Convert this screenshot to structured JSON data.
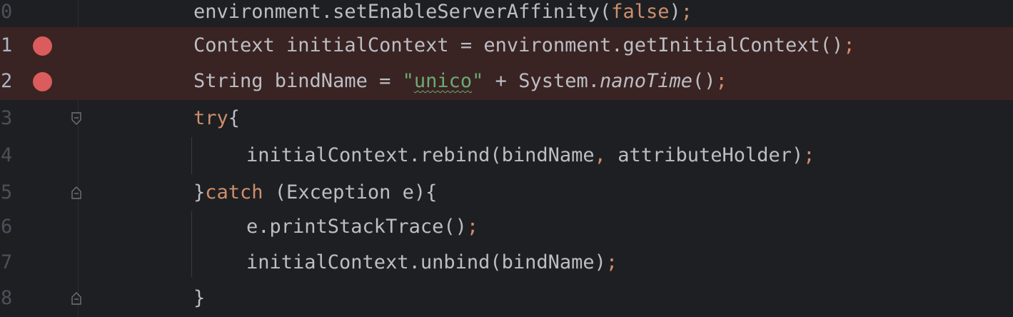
{
  "editor": {
    "lines": [
      {
        "number": "0",
        "breakpoint": false,
        "code": {
          "a": "environment.setEnableServerAffinity(",
          "b": "false",
          "c": ")",
          "d": ";"
        }
      },
      {
        "number": "1",
        "breakpoint": true,
        "code": {
          "a": "Context initialContext = environment.getInitialContext()",
          "b": ";"
        }
      },
      {
        "number": "2",
        "breakpoint": true,
        "code": {
          "a": "String bindName = ",
          "q1": "\"",
          "s": "unico",
          "q2": "\"",
          "b": " + System.",
          "c": "nanoTime",
          "d": "()",
          "e": ";"
        }
      },
      {
        "number": "3",
        "breakpoint": false,
        "code": {
          "a": "try",
          "b": "{"
        }
      },
      {
        "number": "4",
        "breakpoint": false,
        "code": {
          "a": "initialContext.rebind(bindName",
          "b": ",",
          "c": " attributeHolder)",
          "d": ";"
        }
      },
      {
        "number": "5",
        "breakpoint": false,
        "code": {
          "a": "}",
          "b": "catch",
          "c": " (Exception e){"
        }
      },
      {
        "number": "6",
        "breakpoint": false,
        "code": {
          "a": "e.printStackTrace()",
          "b": ";"
        }
      },
      {
        "number": "7",
        "breakpoint": false,
        "code": {
          "a": "initialContext.unbind(bindName)",
          "b": ";"
        }
      },
      {
        "number": "8",
        "breakpoint": false,
        "code": {
          "a": "}"
        }
      }
    ]
  },
  "colors": {
    "background": "#1e1f22",
    "breakpoint_line": "#3a2323",
    "breakpoint_dot": "#db5c5c",
    "keyword": "#cf8e6d",
    "string": "#6aab73",
    "text": "#bcbec4"
  },
  "icons": {
    "breakpoint": "breakpoint-icon",
    "fold_start": "fold-start-icon",
    "fold_end": "fold-end-icon"
  }
}
